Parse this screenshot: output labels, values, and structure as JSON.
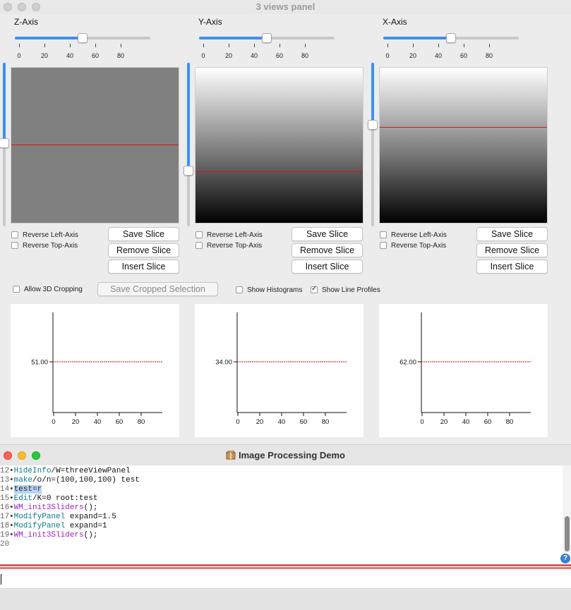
{
  "panel_window": {
    "title": "3 views panel",
    "panels": [
      {
        "title": "Z-Axis",
        "ticks": [
          "0",
          "20",
          "40",
          "60",
          "80"
        ],
        "horizontal_slider_value": 50,
        "vertical_slider_value": 51,
        "reverse_left_label": "Reverse Left-Axis",
        "reverse_top_label": "Reverse Top-Axis",
        "save_label": "Save Slice",
        "remove_label": "Remove Slice",
        "insert_label": "Insert Slice",
        "profile_value_label": "51.00",
        "profile_x_ticks": [
          "0",
          "20",
          "40",
          "60",
          "80"
        ],
        "image_style": "flat gray"
      },
      {
        "title": "Y-Axis",
        "ticks": [
          "0",
          "20",
          "40",
          "60",
          "80"
        ],
        "horizontal_slider_value": 50,
        "vertical_slider_value": 34,
        "reverse_left_label": "Reverse Left-Axis",
        "reverse_top_label": "Reverse Top-Axis",
        "save_label": "Save Slice",
        "remove_label": "Remove Slice",
        "insert_label": "Insert Slice",
        "profile_value_label": "34.00",
        "profile_x_ticks": [
          "0",
          "20",
          "40",
          "60",
          "80"
        ],
        "image_style": "vertical gradient white to black"
      },
      {
        "title": "X-Axis",
        "ticks": [
          "0",
          "20",
          "40",
          "60",
          "80"
        ],
        "horizontal_slider_value": 50,
        "vertical_slider_value": 62,
        "reverse_left_label": "Reverse Left-Axis",
        "reverse_top_label": "Reverse Top-Axis",
        "save_label": "Save Slice",
        "remove_label": "Remove Slice",
        "insert_label": "Insert Slice",
        "profile_value_label": "62.00",
        "profile_x_ticks": [
          "0",
          "20",
          "40",
          "60",
          "80"
        ],
        "image_style": "vertical gradient white to black"
      }
    ],
    "allow_3d_cropping_label": "Allow 3D Cropping",
    "allow_3d_cropping_checked": false,
    "save_cropped_label": "Save Cropped Selection",
    "show_histograms_label": "Show Histograms",
    "show_histograms_checked": false,
    "show_line_profiles_label": "Show Line Profiles",
    "show_line_profiles_checked": true
  },
  "demo_window": {
    "title": "Image Processing Demo",
    "title_icon": "package-icon",
    "code_lines": [
      {
        "num": "12",
        "parts": [
          {
            "t": "HideInfo",
            "c": "cmd"
          },
          {
            "t": "/W=threeViewPanel",
            "c": "plain"
          }
        ]
      },
      {
        "num": "13",
        "parts": [
          {
            "t": "make",
            "c": "cmd"
          },
          {
            "t": "/o/n=(100,100,100) test",
            "c": "plain"
          }
        ]
      },
      {
        "num": "14",
        "parts": [
          {
            "t": "test=r",
            "c": "sel"
          }
        ]
      },
      {
        "num": "15",
        "parts": [
          {
            "t": "Edit",
            "c": "cmd"
          },
          {
            "t": "/K=0 root:test",
            "c": "plain"
          }
        ]
      },
      {
        "num": "16",
        "parts": [
          {
            "t": "WM_init3Sliders",
            "c": "fn"
          },
          {
            "t": "();",
            "c": "plain"
          }
        ]
      },
      {
        "num": "17",
        "parts": [
          {
            "t": "ModifyPanel",
            "c": "cmd"
          },
          {
            "t": " expand=1.5",
            "c": "plain"
          }
        ]
      },
      {
        "num": "18",
        "parts": [
          {
            "t": "ModifyPanel",
            "c": "cmd"
          },
          {
            "t": " expand=1",
            "c": "plain"
          }
        ]
      },
      {
        "num": "19",
        "parts": [
          {
            "t": "WM_init3Sliders",
            "c": "fn"
          },
          {
            "t": "();",
            "c": "plain"
          }
        ]
      },
      {
        "num": "20",
        "parts": []
      }
    ],
    "command_input_value": "",
    "help_label": "?"
  },
  "colors": {
    "accent": "#3d8ef5",
    "slice_line": "#e01010",
    "profile_line": "#cc0000"
  }
}
